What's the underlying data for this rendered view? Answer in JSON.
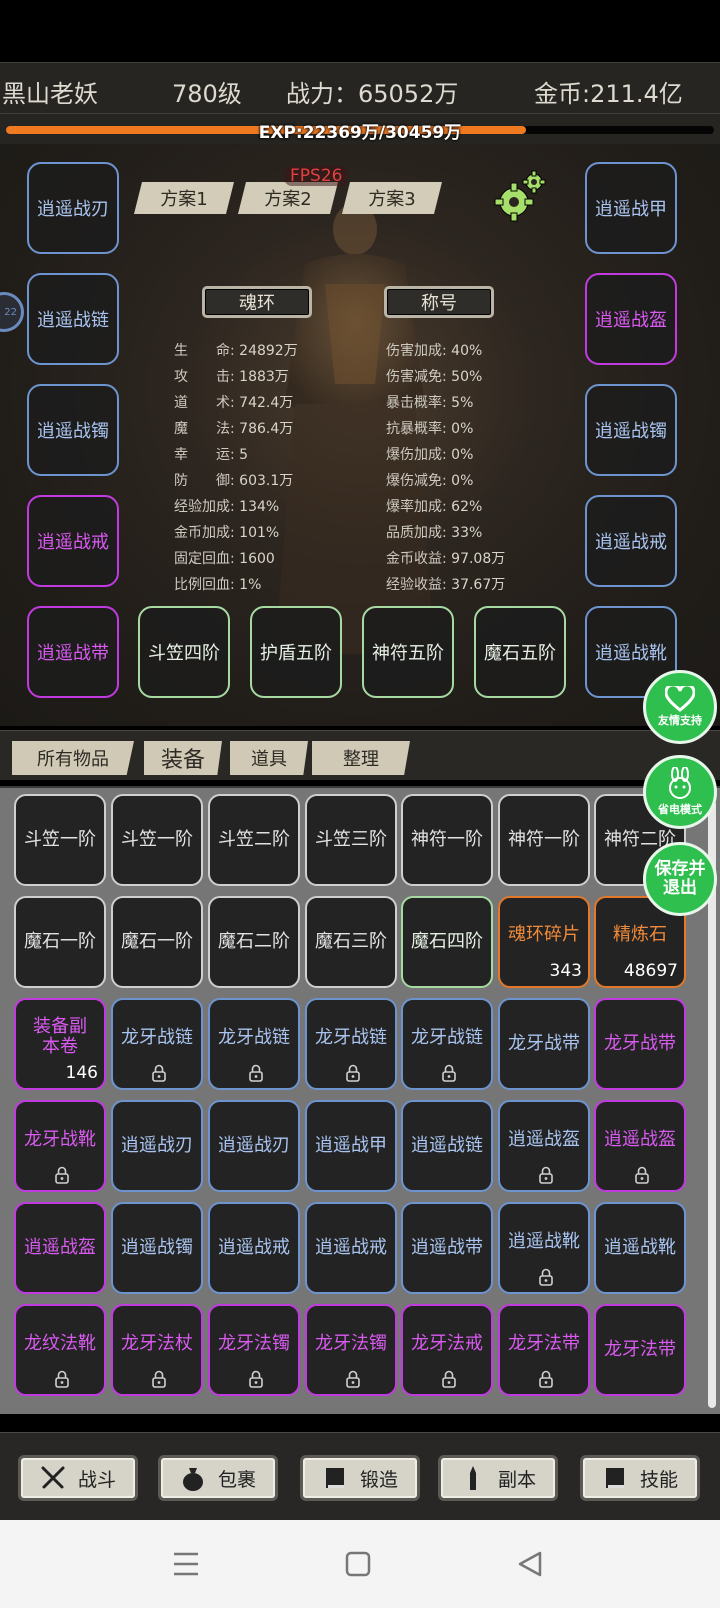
{
  "header": {
    "name": "黑山老妖",
    "level": "780级",
    "power": "战力：65052万",
    "gold": "金币:211.4亿"
  },
  "exp": {
    "text": "EXP:22369万/30459万",
    "fraction": 0.734
  },
  "fps": "FPS26",
  "plans": [
    "方案1",
    "方案2",
    "方案3"
  ],
  "equip_left": [
    {
      "name": "逍遥战刃",
      "q": "blue"
    },
    {
      "name": "逍遥战链",
      "q": "blue"
    },
    {
      "name": "逍遥战镯",
      "q": "blue"
    },
    {
      "name": "逍遥战戒",
      "q": "purple"
    },
    {
      "name": "逍遥战带",
      "q": "purple"
    }
  ],
  "equip_right": [
    {
      "name": "逍遥战甲",
      "q": "blue"
    },
    {
      "name": "逍遥战盔",
      "q": "purple"
    },
    {
      "name": "逍遥战镯",
      "q": "blue"
    },
    {
      "name": "逍遥战戒",
      "q": "blue"
    },
    {
      "name": "逍遥战靴",
      "q": "blue"
    }
  ],
  "equip_bottom": [
    "斗笠四阶",
    "护盾五阶",
    "神符五阶",
    "魔石五阶"
  ],
  "buttons": {
    "soul_ring": "魂环",
    "title": "称号"
  },
  "side_circle": "22",
  "stats_left": [
    {
      "k": "生　　命:",
      "v": "24892万"
    },
    {
      "k": "攻　　击:",
      "v": "1883万"
    },
    {
      "k": "道　　术:",
      "v": "742.4万"
    },
    {
      "k": "魔　　法:",
      "v": "786.4万"
    },
    {
      "k": "幸　　运:",
      "v": "5"
    },
    {
      "k": "防　　御:",
      "v": "603.1万"
    },
    {
      "k": "经验加成:",
      "v": "134%"
    },
    {
      "k": "金币加成:",
      "v": "101%"
    },
    {
      "k": "固定回血:",
      "v": "1600"
    },
    {
      "k": "比例回血:",
      "v": "1%"
    }
  ],
  "stats_right": [
    {
      "k": "伤害加成:",
      "v": "40%"
    },
    {
      "k": "伤害减免:",
      "v": "50%"
    },
    {
      "k": "暴击概率:",
      "v": "5%"
    },
    {
      "k": "抗暴概率:",
      "v": "0%"
    },
    {
      "k": "爆伤加成:",
      "v": "0%"
    },
    {
      "k": "爆伤减免:",
      "v": "0%"
    },
    {
      "k": "爆率加成:",
      "v": "62%"
    },
    {
      "k": "品质加成:",
      "v": "33%"
    },
    {
      "k": "金币收益:",
      "v": "97.08万"
    },
    {
      "k": "经验收益:",
      "v": "37.67万"
    }
  ],
  "inv_tabs": [
    "所有物品",
    "装备",
    "道具",
    "整理"
  ],
  "inventory": [
    [
      {
        "n": "斗笠一阶",
        "q": "white"
      },
      {
        "n": "斗笠一阶",
        "q": "white"
      },
      {
        "n": "斗笠二阶",
        "q": "white"
      },
      {
        "n": "斗笠三阶",
        "q": "white"
      },
      {
        "n": "神符一阶",
        "q": "white"
      },
      {
        "n": "神符一阶",
        "q": "white"
      },
      {
        "n": "神符二阶",
        "q": "white"
      }
    ],
    [
      {
        "n": "魔石一阶",
        "q": "white"
      },
      {
        "n": "魔石一阶",
        "q": "white"
      },
      {
        "n": "魔石二阶",
        "q": "white"
      },
      {
        "n": "魔石三阶",
        "q": "white"
      },
      {
        "n": "魔石四阶",
        "q": "green"
      },
      {
        "n": "魂环碎片",
        "q": "orange",
        "c": "343"
      },
      {
        "n": "精炼石",
        "q": "orange",
        "c": "48697"
      }
    ],
    [
      {
        "n": "装备副本卷",
        "q": "purple",
        "c": "146"
      },
      {
        "n": "龙牙战链",
        "q": "blue",
        "l": true
      },
      {
        "n": "龙牙战链",
        "q": "blue",
        "l": true
      },
      {
        "n": "龙牙战链",
        "q": "blue",
        "l": true
      },
      {
        "n": "龙牙战链",
        "q": "blue",
        "l": true
      },
      {
        "n": "龙牙战带",
        "q": "blue"
      },
      {
        "n": "龙牙战带",
        "q": "purple"
      }
    ],
    [
      {
        "n": "龙牙战靴",
        "q": "purple",
        "l": true
      },
      {
        "n": "逍遥战刃",
        "q": "blue"
      },
      {
        "n": "逍遥战刃",
        "q": "blue"
      },
      {
        "n": "逍遥战甲",
        "q": "blue"
      },
      {
        "n": "逍遥战链",
        "q": "blue"
      },
      {
        "n": "逍遥战盔",
        "q": "blue",
        "l": true
      },
      {
        "n": "逍遥战盔",
        "q": "purple",
        "l": true
      }
    ],
    [
      {
        "n": "逍遥战盔",
        "q": "purple"
      },
      {
        "n": "逍遥战镯",
        "q": "blue"
      },
      {
        "n": "逍遥战戒",
        "q": "blue"
      },
      {
        "n": "逍遥战戒",
        "q": "blue"
      },
      {
        "n": "逍遥战带",
        "q": "blue"
      },
      {
        "n": "逍遥战靴",
        "q": "blue",
        "l": true
      },
      {
        "n": "逍遥战靴",
        "q": "blue"
      }
    ],
    [
      {
        "n": "龙纹法靴",
        "q": "purple",
        "l": true
      },
      {
        "n": "龙牙法杖",
        "q": "purple",
        "l": true
      },
      {
        "n": "龙牙法镯",
        "q": "purple",
        "l": true
      },
      {
        "n": "龙牙法镯",
        "q": "purple",
        "l": true
      },
      {
        "n": "龙牙法戒",
        "q": "purple",
        "l": true
      },
      {
        "n": "龙牙法带",
        "q": "purple",
        "l": true
      },
      {
        "n": "龙牙法带",
        "q": "purple"
      }
    ]
  ],
  "floats": {
    "support": "友情支持",
    "power_save": "省电模式",
    "save_exit": "保存并退出"
  },
  "nav": [
    {
      "label": "战斗",
      "icon": "swords-icon"
    },
    {
      "label": "包裹",
      "icon": "bag-icon"
    },
    {
      "label": "锻造",
      "icon": "book-icon"
    },
    {
      "label": "副本",
      "icon": "tower-icon"
    },
    {
      "label": "技能",
      "icon": "skillbook-icon"
    }
  ],
  "colors": {
    "blue": "#6d94cf",
    "purple": "#c13ae0",
    "green": "#a7d9a2",
    "orange": "#e3772a",
    "exp": "#f07a22",
    "float": "#2ebf4f"
  }
}
